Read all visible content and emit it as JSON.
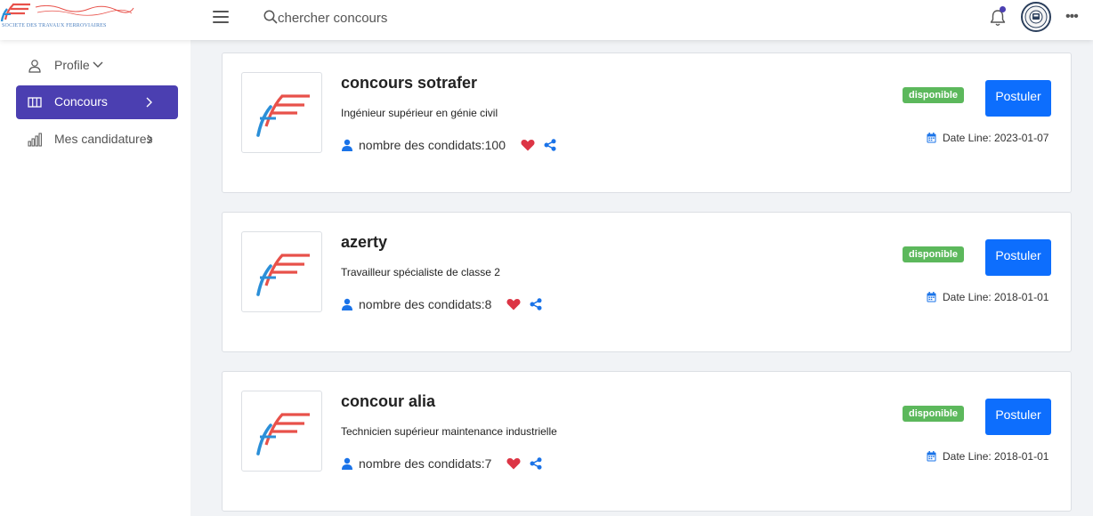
{
  "header": {
    "logo_subtitle": "SOCIETE DES TRAVAUX FERROVIAIRES",
    "search_placeholder": "chercher concours"
  },
  "sidebar": {
    "items": [
      {
        "label": "Profile",
        "icon": "user-icon"
      },
      {
        "label": "Concours",
        "icon": "columns-icon",
        "active": true
      },
      {
        "label": "Mes candidatures",
        "icon": "bar-chart-icon"
      }
    ]
  },
  "concours": [
    {
      "title": "concours sotrafer",
      "subtitle": "Ingénieur supérieur en génie civil",
      "candidates_label": "nombre des condidats:100",
      "status": "disponible",
      "button": "Postuler",
      "dateline": "Date Line: 2023-01-07"
    },
    {
      "title": "azerty",
      "subtitle": "Travailleur spécialiste de classe 2",
      "candidates_label": "nombre des condidats:8",
      "status": "disponible",
      "button": "Postuler",
      "dateline": "Date Line: 2018-01-01"
    },
    {
      "title": "concour alia",
      "subtitle": "Technicien supérieur maintenance industrielle",
      "candidates_label": "nombre des condidats:7",
      "status": "disponible",
      "button": "Postuler",
      "dateline": "Date Line: 2018-01-01"
    }
  ],
  "colors": {
    "primary": "#4b3fb1",
    "button": "#0d6efd",
    "badge": "#5cb85c",
    "heart": "#dc3545",
    "logo_red": "#e8514a",
    "logo_blue": "#2b8fd8"
  }
}
